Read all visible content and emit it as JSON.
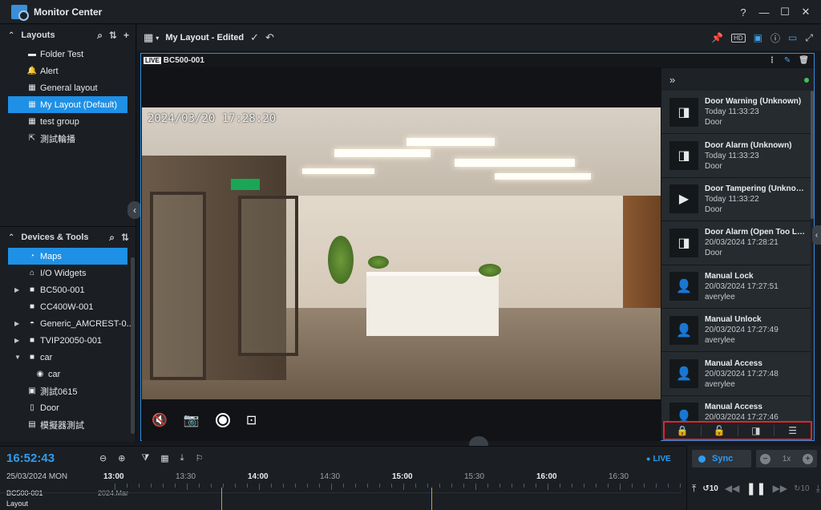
{
  "window": {
    "title": "Monitor Center",
    "controls": [
      "?",
      "—",
      "☐",
      "✕"
    ]
  },
  "layouts": {
    "header": "Layouts",
    "items": [
      {
        "label": "Folder Test",
        "icon": "folder-icon",
        "glyph": "▬"
      },
      {
        "label": "Alert",
        "icon": "bell-icon",
        "glyph": "🔔"
      },
      {
        "label": "General layout",
        "icon": "layout-grid-icon",
        "glyph": "▦"
      },
      {
        "label": "My Layout (Default)",
        "icon": "layout-grid-icon",
        "glyph": "▦",
        "selected": true
      },
      {
        "label": "test group",
        "icon": "layout-grid-icon",
        "glyph": "▦"
      },
      {
        "label": "測試輪播",
        "icon": "export-icon",
        "glyph": "⇱"
      }
    ]
  },
  "devices": {
    "header": "Devices & Tools",
    "items": [
      {
        "label": "Maps",
        "icon": "map-icon",
        "glyph": "◔",
        "selected": true
      },
      {
        "label": "I/O Widgets",
        "icon": "io-widget-icon",
        "glyph": "⌂"
      },
      {
        "label": "BC500-001",
        "icon": "camera-icon",
        "glyph": "■",
        "expandable": true
      },
      {
        "label": "CC400W-001",
        "icon": "camera-icon",
        "glyph": "■"
      },
      {
        "label": "Generic_AMCREST-0...",
        "icon": "dome-camera-icon",
        "glyph": "◓",
        "expandable": true
      },
      {
        "label": "TVIP20050-001",
        "icon": "camera-icon",
        "glyph": "■",
        "expandable": true
      },
      {
        "label": "car",
        "icon": "camera-icon",
        "glyph": "■",
        "expanded": true
      },
      {
        "label": "car",
        "icon": "camera-view-icon",
        "glyph": "◉",
        "child": true
      },
      {
        "label": "測試0615",
        "icon": "folder-camera-icon",
        "glyph": "▣"
      },
      {
        "label": "Door",
        "icon": "door-icon",
        "glyph": "▯"
      },
      {
        "label": "模擬器測試",
        "icon": "simulator-icon",
        "glyph": "▤"
      }
    ]
  },
  "toolbar": {
    "layout_name": "My Layout - Edited"
  },
  "viewport": {
    "live_tag": "LIVE",
    "camera_name": "BC500-001",
    "osd_timestamp": "2024/03/20 17:28:20"
  },
  "events": [
    {
      "title": "Door Warning (Unknown)",
      "time": "Today 11:33:23",
      "source": "Door",
      "icon": "door-icon",
      "glyph": "◨"
    },
    {
      "title": "Door Alarm (Unknown)",
      "time": "Today 11:33:23",
      "source": "Door",
      "icon": "door-icon",
      "glyph": "◨"
    },
    {
      "title": "Door Tampering (Unknown)",
      "time": "Today 11:33:22",
      "source": "Door",
      "icon": "play-circle-icon",
      "glyph": "▶"
    },
    {
      "title": "Door Alarm (Open Too Lon...",
      "time": "20/03/2024 17:28:21",
      "source": "Door",
      "icon": "door-icon",
      "glyph": "◨"
    },
    {
      "title": "Manual Lock",
      "time": "20/03/2024 17:27:51",
      "source": "averylee",
      "icon": "user-icon",
      "glyph": "👤"
    },
    {
      "title": "Manual Unlock",
      "time": "20/03/2024 17:27:49",
      "source": "averylee",
      "icon": "user-icon",
      "glyph": "👤"
    },
    {
      "title": "Manual Access",
      "time": "20/03/2024 17:27:48",
      "source": "averylee",
      "icon": "user-icon",
      "glyph": "👤"
    },
    {
      "title": "Manual Access",
      "time": "20/03/2024 17:27:46",
      "source": "averylee",
      "icon": "user-icon",
      "glyph": "👤"
    }
  ],
  "timeline": {
    "clock": "16:52:43",
    "date": "25/03/2024 MON",
    "live_label": "LIVE",
    "ticks": [
      {
        "label": "13:00",
        "major": true
      },
      {
        "label": "13:30",
        "major": false
      },
      {
        "label": "14:00",
        "major": true
      },
      {
        "label": "14:30",
        "major": false
      },
      {
        "label": "15:00",
        "major": true
      },
      {
        "label": "15:30",
        "major": false
      },
      {
        "label": "16:00",
        "major": true
      },
      {
        "label": "16:30",
        "major": false
      }
    ],
    "tracks": [
      {
        "name": "BC500-001",
        "date_marker": "2024.Mar"
      },
      {
        "name": "Layout"
      }
    ]
  },
  "playback": {
    "sync_label": "Sync",
    "speed": "1x",
    "skip_back": "10",
    "skip_forward": "10"
  },
  "colors": {
    "accent": "#1e90e6",
    "highlight_border": "#e0242c",
    "live": "#2e9cf2"
  }
}
